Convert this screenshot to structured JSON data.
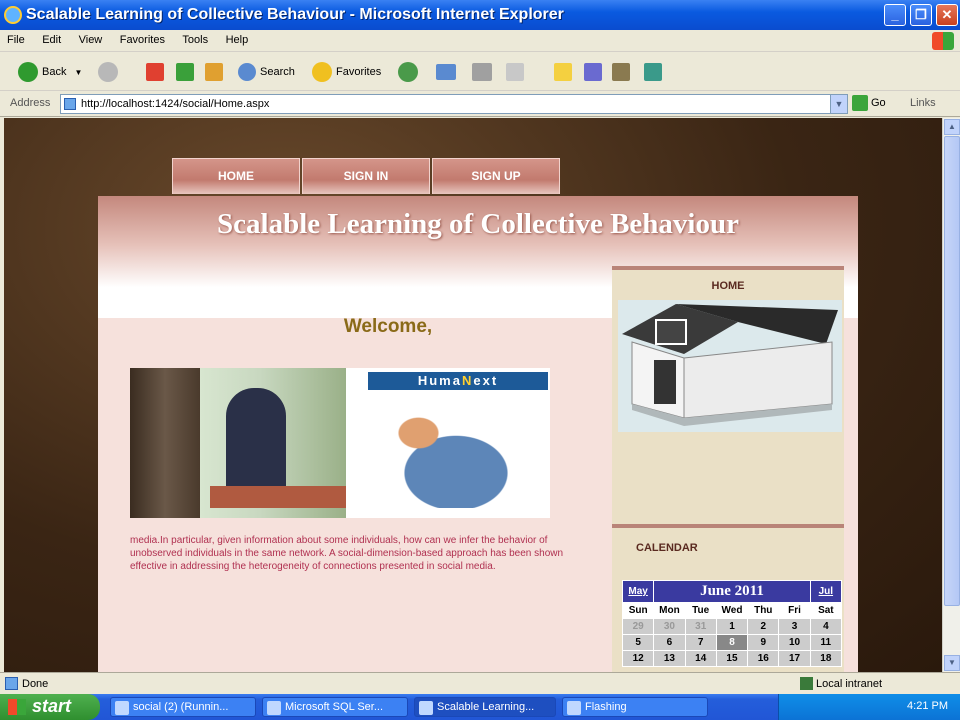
{
  "window": {
    "title": "Scalable Learning of Collective Behaviour - Microsoft Internet Explorer",
    "min_label": "_",
    "max_label": "❐",
    "close_label": "✕"
  },
  "menu": [
    "File",
    "Edit",
    "View",
    "Favorites",
    "Tools",
    "Help"
  ],
  "toolbar": {
    "back_label": "Back",
    "search_label": "Search",
    "favorites_label": "Favorites"
  },
  "address": {
    "label": "Address",
    "url": "http://localhost:1424/social/Home.aspx",
    "go_label": "Go",
    "links_label": "Links"
  },
  "nav": [
    "HOME",
    "SIGN IN",
    "SIGN UP"
  ],
  "page": {
    "header_title": "Scalable Learning of Collective Behaviour",
    "welcome": "Welcome,",
    "brand_part1": "Huma",
    "brand_mid": "N",
    "brand_part2": "ext",
    "description": "media.In particular, given information about some individuals, how can we infer the behavior of unobserved individuals in the same network. A social-dimension-based approach has been shown effective in addressing the heterogeneity of connections presented in social media."
  },
  "sidebar": {
    "home_title": "HOME",
    "calendar_title": "CALENDAR"
  },
  "calendar": {
    "prev": "May",
    "month": "June 2011",
    "next": "Jul",
    "dow": [
      "Sun",
      "Mon",
      "Tue",
      "Wed",
      "Thu",
      "Fri",
      "Sat"
    ],
    "weeks": [
      [
        "29",
        "30",
        "31",
        "1",
        "2",
        "3",
        "4"
      ],
      [
        "5",
        "6",
        "7",
        "8",
        "9",
        "10",
        "11"
      ],
      [
        "12",
        "13",
        "14",
        "15",
        "16",
        "17",
        "18"
      ]
    ]
  },
  "status": {
    "left": "Done",
    "zone": "Local intranet"
  },
  "taskbar": {
    "start": "start",
    "tasks": [
      "social (2) (Runnin...",
      "Microsoft SQL Ser...",
      "Scalable Learning...",
      "Flashing"
    ],
    "clock": "4:21 PM"
  }
}
